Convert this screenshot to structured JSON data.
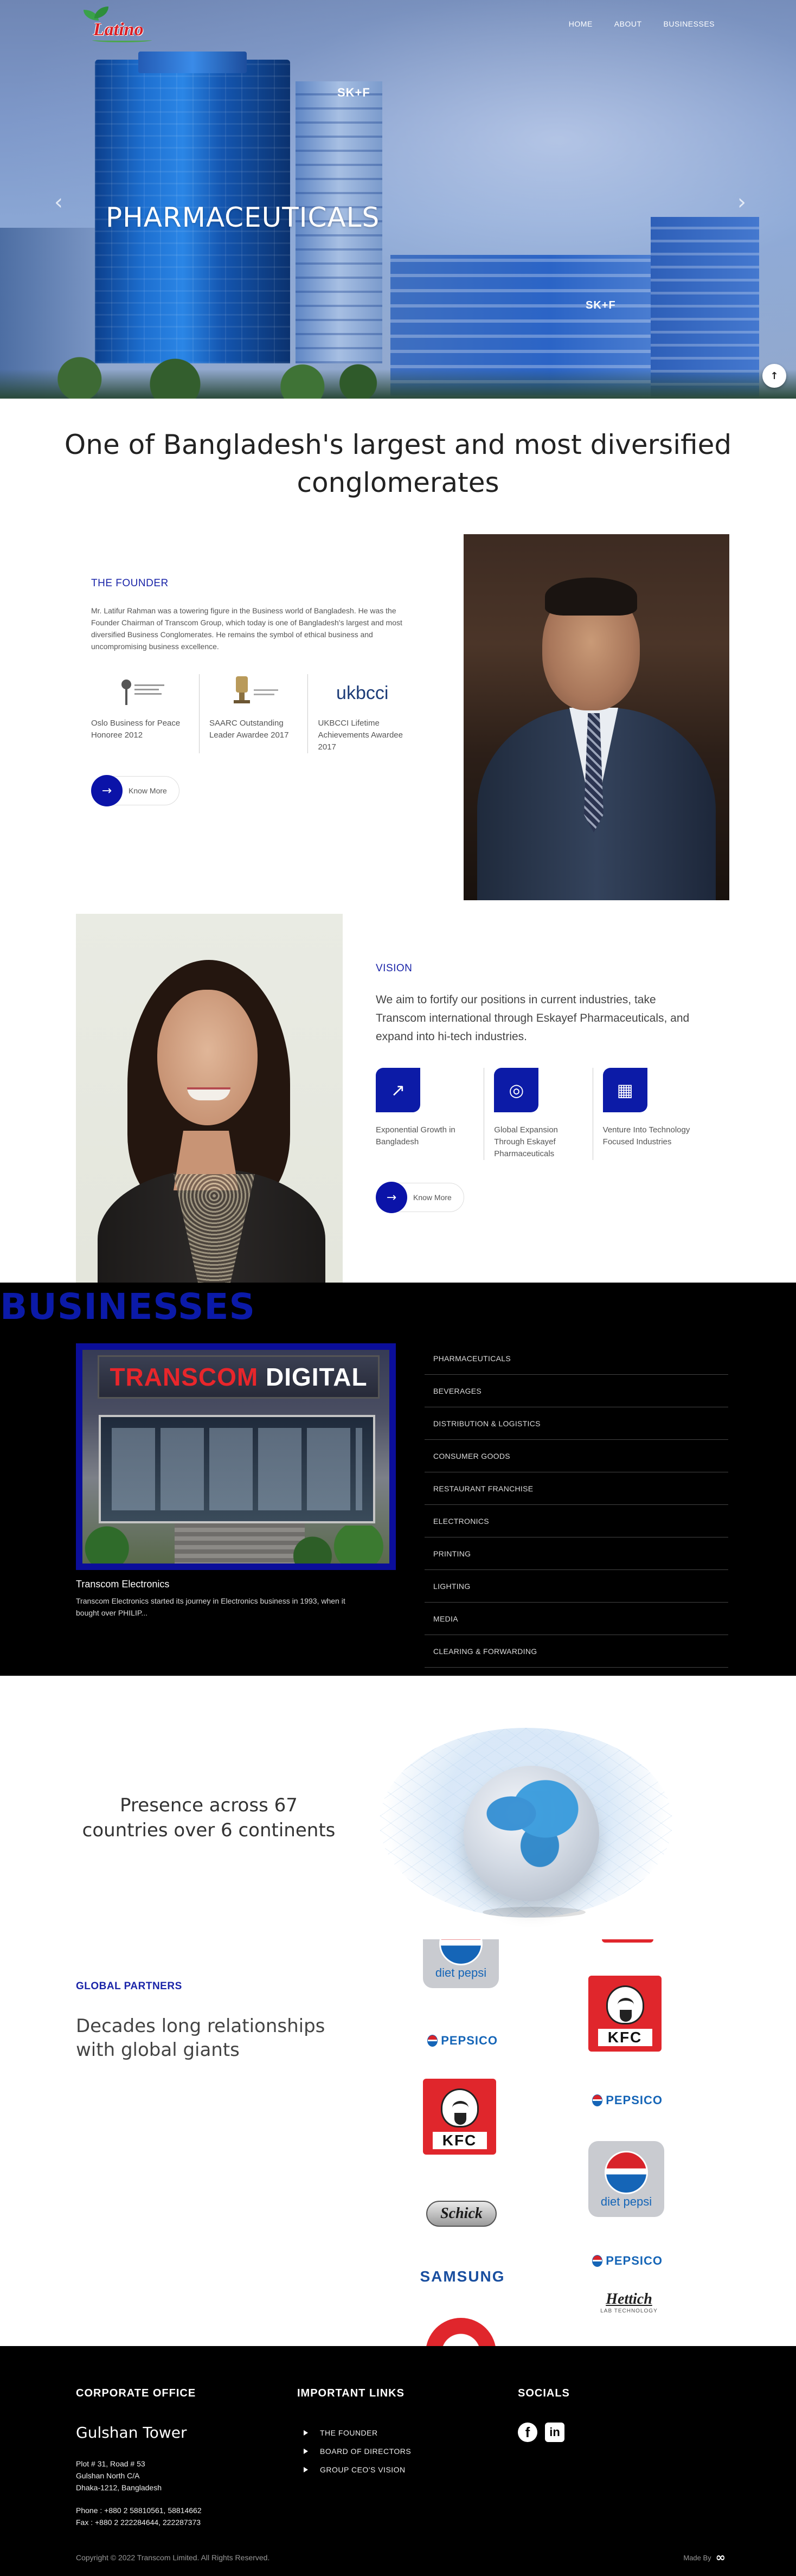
{
  "brand": {
    "logo_text": "Latino"
  },
  "nav": {
    "items": [
      "HOME",
      "ABOUT",
      "BUSINESSES"
    ]
  },
  "hero": {
    "title": "PHARMACEUTICALS",
    "sign_text": "SK+F",
    "prev_arrow": "‹",
    "next_arrow": "›",
    "scroll_top": "↑"
  },
  "intro": {
    "heading": "One of Bangladesh's largest and most diversified conglomerates"
  },
  "founder": {
    "label": "THE FOUNDER",
    "description": "Mr. Latifur Rahman was a towering figure in the Business world of Bangladesh. He was the Founder Chairman of Transcom Group, which today is one of Bangladesh's largest and most diversified Business Conglomerates. He remains the symbol of ethical business and uncompromising business excellence.",
    "awards": [
      {
        "caption": "Oslo Business for Peace Honoree 2012",
        "icon": "business-for-peace-logo"
      },
      {
        "caption": "SAARC Outstanding Leader Awardee 2017",
        "icon": "saarc-award-logo"
      },
      {
        "caption": "UKBCCI Lifetime Achievements Awardee 2017",
        "icon": "ukbcci-logo",
        "logo_text": "ukbcci"
      }
    ],
    "cta": {
      "arrow": "→",
      "label": "Know More"
    }
  },
  "vision": {
    "label": "VISION",
    "statement": "We aim to fortify our positions in current industries, take Transcom international through Eskayef Pharmaceuticals, and expand into hi-tech industries.",
    "goals": [
      {
        "caption": "Exponential Growth in Bangladesh",
        "icon": "growth-chart-icon",
        "glyph": "↗"
      },
      {
        "caption": "Global Expansion Through Eskayef Pharmaceuticals",
        "icon": "globe-icon",
        "glyph": "◎"
      },
      {
        "caption": "Venture Into Technology Focused Industries",
        "icon": "chip-icon",
        "glyph": "▦"
      }
    ],
    "cta": {
      "arrow": "→",
      "label": "Know More"
    }
  },
  "businesses": {
    "heading": "BUSINESSES",
    "featured": {
      "sign_brand": "TRANSCOM",
      "sign_suffix": " DIGITAL",
      "title": "Transcom Electronics",
      "description": "Transcom Electronics started its journey in Electronics business in 1993, when it bought over PHILIP..."
    },
    "list": [
      "PHARMACEUTICALS",
      "BEVERAGES",
      "DISTRIBUTION & LOGISTICS",
      "CONSUMER GOODS",
      "RESTAURANT FRANCHISE",
      "ELECTRONICS",
      "PRINTING",
      "LIGHTING",
      "MEDIA",
      "CLEARING & FORWARDING"
    ]
  },
  "presence": {
    "text": "Presence across 67 countries over 6 continents"
  },
  "partners": {
    "label": "GLOBAL PARTNERS",
    "heading": "Decades long relationships with global giants",
    "logos": {
      "diet_pepsi": "diet pepsi",
      "pepsico": "PEPSICO",
      "kfc": "KFC",
      "schick": "Schick",
      "samsung": "SAMSUNG",
      "hettich": "Hettich",
      "hettich_sub": "LAB TECHNOLOGY"
    }
  },
  "footer": {
    "office": {
      "heading": "CORPORATE OFFICE",
      "building": "Gulshan Tower",
      "address": [
        "Plot # 31, Road # 53",
        "Gulshan North C/A",
        "Dhaka-1212, Bangladesh"
      ],
      "phone": "Phone : +880 2 58810561, 58814662",
      "fax": "Fax : +880 2 222284644, 222287373"
    },
    "links": {
      "heading": "IMPORTANT LINKS",
      "items": [
        "THE FOUNDER",
        "BOARD OF DIRECTORS",
        "GROUP CEO'S VISION"
      ]
    },
    "socials": {
      "heading": "SOCIALS",
      "facebook": "f",
      "linkedin": "in"
    },
    "copyright": "Copyright © 2022 Transcom Limited. All Rights Reserved.",
    "made_by": "Made By",
    "made_by_mark": "∞"
  }
}
